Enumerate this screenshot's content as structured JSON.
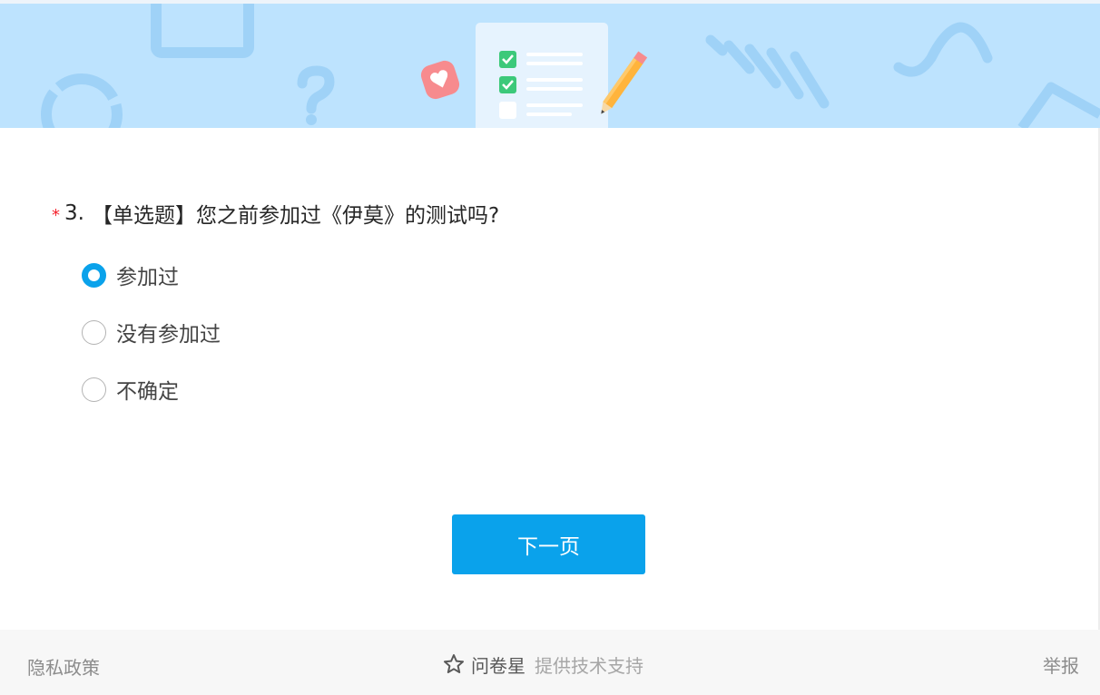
{
  "colors": {
    "banner_bg": "#bde3fe",
    "accent": "#0aa2eb",
    "required": "#f5222d",
    "footer_bg": "#f7f7f7"
  },
  "banner": {
    "illustration": "survey-checklist-with-pencil-and-heart"
  },
  "question": {
    "required_mark": "*",
    "number": "3.",
    "text": "【单选题】您之前参加过《伊莫》的测试吗?",
    "options": [
      {
        "label": "参加过",
        "selected": true
      },
      {
        "label": "没有参加过",
        "selected": false
      },
      {
        "label": "不确定",
        "selected": false
      }
    ]
  },
  "actions": {
    "next_label": "下一页"
  },
  "footer": {
    "privacy_label": "隐私政策",
    "brand_icon": "star-outline-icon",
    "brand_name": "问卷星",
    "brand_support": "提供技术支持",
    "report_label": "举报"
  }
}
